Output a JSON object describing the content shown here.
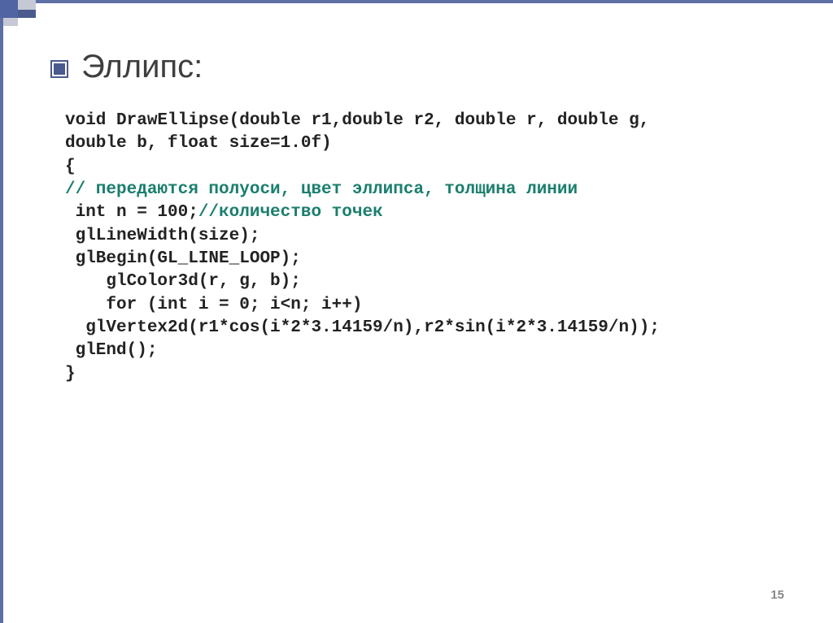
{
  "heading": "Эллипс:",
  "slide_num": "15",
  "code": {
    "l1": "void DrawEllipse(double r1,double r2, double r, double g,",
    "l2": "double b, float size=1.0f)",
    "l3": "{",
    "l4": "// передаются полуоси, цвет эллипса, толщина линии",
    "l5a": " int n = 100;",
    "l5b": "//количество точек",
    "l6": " glLineWidth(size);",
    "l7": " glBegin(GL_LINE_LOOP);",
    "l8": "    glColor3d(r, g, b);",
    "l9": "    for (int i = 0; i<n; i++)",
    "l10": "  glVertex2d(r1*cos(i*2*3.14159/n),r2*sin(i*2*3.14159/n));",
    "l11": " glEnd();",
    "l12": "}"
  }
}
